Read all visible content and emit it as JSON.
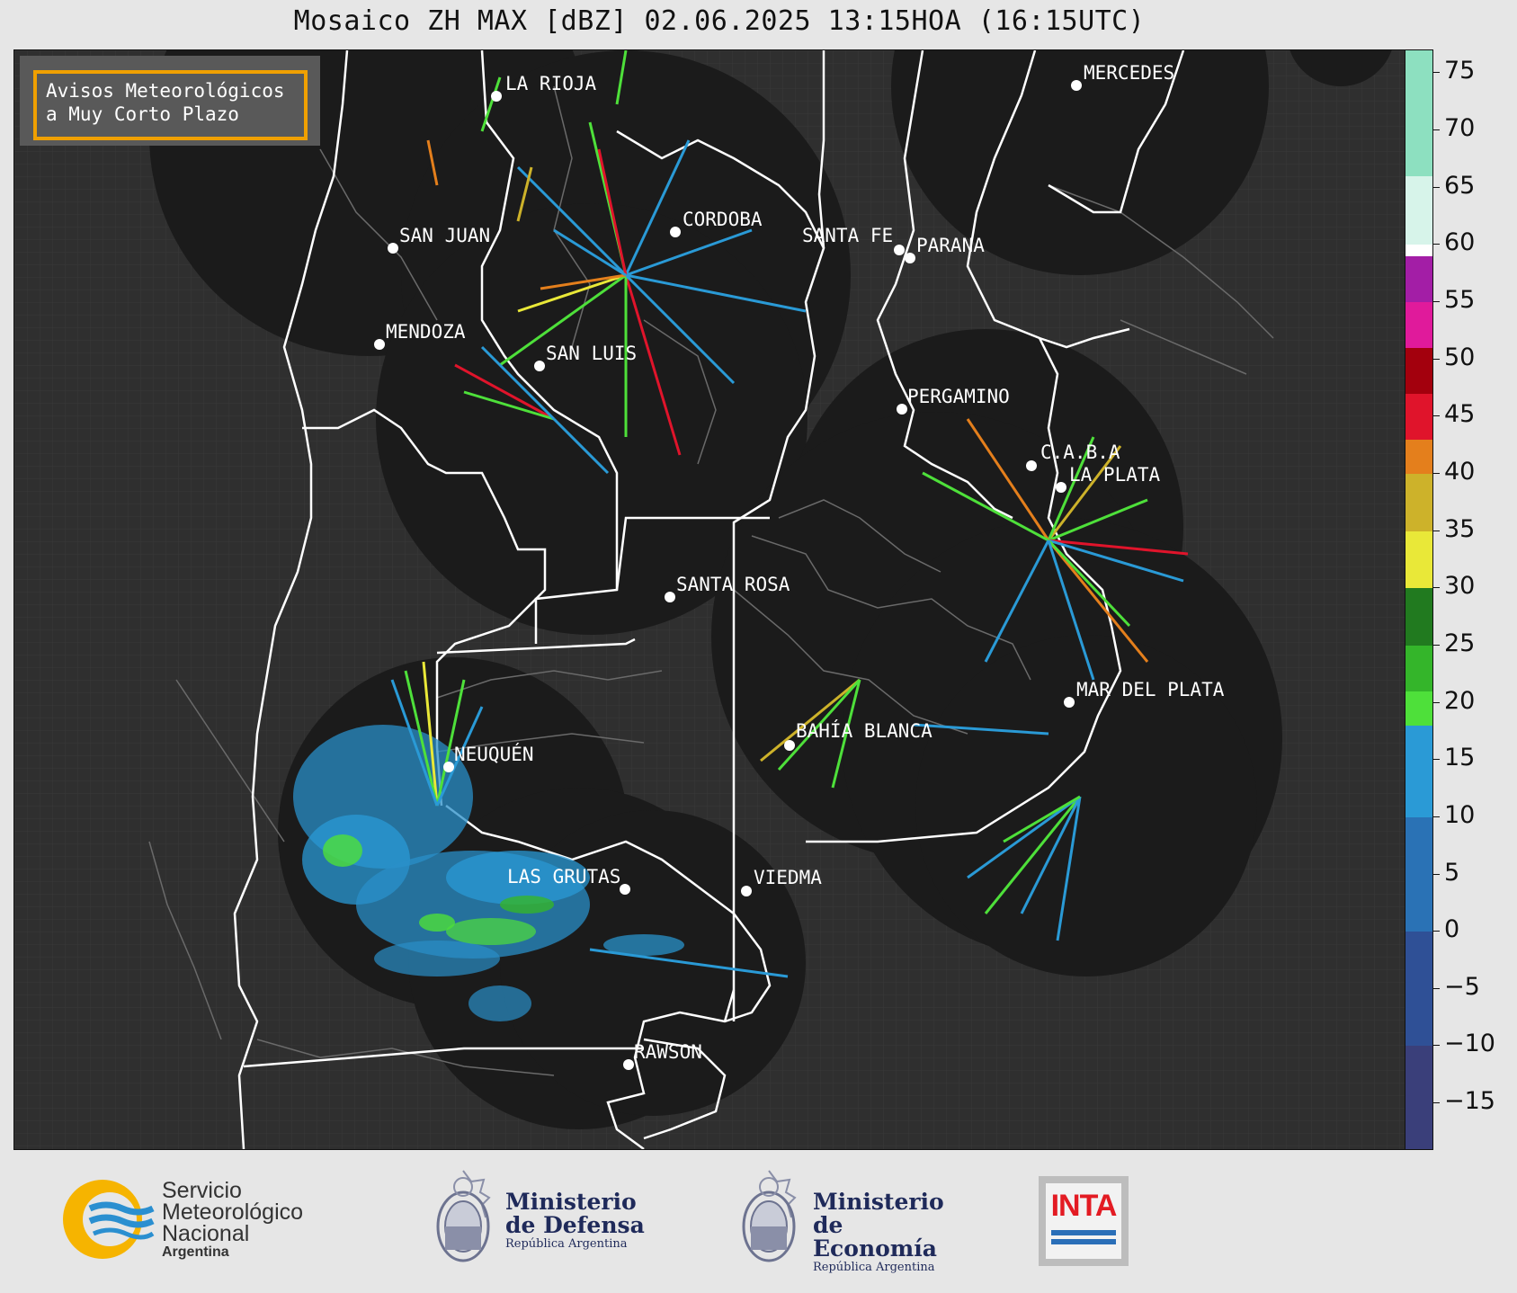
{
  "title": "Mosaico ZH MAX [dBZ] 02.06.2025 13:15HOA (16:15UTC)",
  "warning_box": {
    "line1": "Avisos Meteorológicos",
    "line2": "a Muy Corto Plazo"
  },
  "cities": [
    {
      "name": "LA RIOJA"
    },
    {
      "name": "CORDOBA"
    },
    {
      "name": "SAN JUAN"
    },
    {
      "name": "SANTA FE"
    },
    {
      "name": "PARANA"
    },
    {
      "name": "MENDOZA"
    },
    {
      "name": "SAN LUIS"
    },
    {
      "name": "MERCEDES"
    },
    {
      "name": "PERGAMINO"
    },
    {
      "name": "C.A.B.A"
    },
    {
      "name": "LA PLATA"
    },
    {
      "name": "SANTA ROSA"
    },
    {
      "name": "NEUQUÉN"
    },
    {
      "name": "MAR DEL PLATA"
    },
    {
      "name": "BAHÍA BLANCA"
    },
    {
      "name": "LAS GRUTAS"
    },
    {
      "name": "VIEDMA"
    },
    {
      "name": "RAWSON"
    }
  ],
  "colorbar": {
    "unit": "dBZ",
    "min": -19,
    "max": 77,
    "ticks": [
      "75",
      "70",
      "65",
      "60",
      "55",
      "50",
      "45",
      "40",
      "35",
      "30",
      "25",
      "20",
      "15",
      "10",
      "5",
      "0",
      "−5",
      "−10",
      "−15"
    ],
    "tick_values": [
      75,
      70,
      65,
      60,
      55,
      50,
      45,
      40,
      35,
      30,
      25,
      20,
      15,
      10,
      5,
      0,
      -5,
      -10,
      -15
    ],
    "bands": [
      {
        "from": -19,
        "to": -10,
        "color": "#3a3f7a"
      },
      {
        "from": -10,
        "to": 0,
        "color": "#2f5096"
      },
      {
        "from": 0,
        "to": 10,
        "color": "#2a72b5"
      },
      {
        "from": 10,
        "to": 18,
        "color": "#2a9ad6"
      },
      {
        "from": 18,
        "to": 21,
        "color": "#4ee03a"
      },
      {
        "from": 21,
        "to": 25,
        "color": "#34b52a"
      },
      {
        "from": 25,
        "to": 30,
        "color": "#217a1f"
      },
      {
        "from": 30,
        "to": 35,
        "color": "#e9e838"
      },
      {
        "from": 35,
        "to": 40,
        "color": "#cdb22a"
      },
      {
        "from": 40,
        "to": 43,
        "color": "#e47f1c"
      },
      {
        "from": 43,
        "to": 47,
        "color": "#e0142b"
      },
      {
        "from": 47,
        "to": 51,
        "color": "#a3000d"
      },
      {
        "from": 51,
        "to": 55,
        "color": "#e01a9b"
      },
      {
        "from": 55,
        "to": 59,
        "color": "#a31ea6"
      },
      {
        "from": 59,
        "to": 60,
        "color": "#ffffff"
      },
      {
        "from": 60,
        "to": 66,
        "color": "#d7f4ea"
      },
      {
        "from": 66,
        "to": 77,
        "color": "#8de0c0"
      }
    ]
  },
  "logos": {
    "smn": {
      "line1": "Servicio",
      "line2": "Meteorológico",
      "line3": "Nacional",
      "line4": "Argentina"
    },
    "defensa": {
      "line1": "Ministerio",
      "line2": "de Defensa",
      "line3": "República Argentina"
    },
    "economia": {
      "line1": "Ministerio",
      "line2": "de Economía",
      "line3": "República Argentina"
    },
    "inta": {
      "text": "INTA"
    }
  },
  "colors": {
    "map_bg": "#2f2f2f",
    "radar_coverage": "#1b1b1b",
    "border": "#ffffff",
    "warning_frame": "#f0a000"
  }
}
